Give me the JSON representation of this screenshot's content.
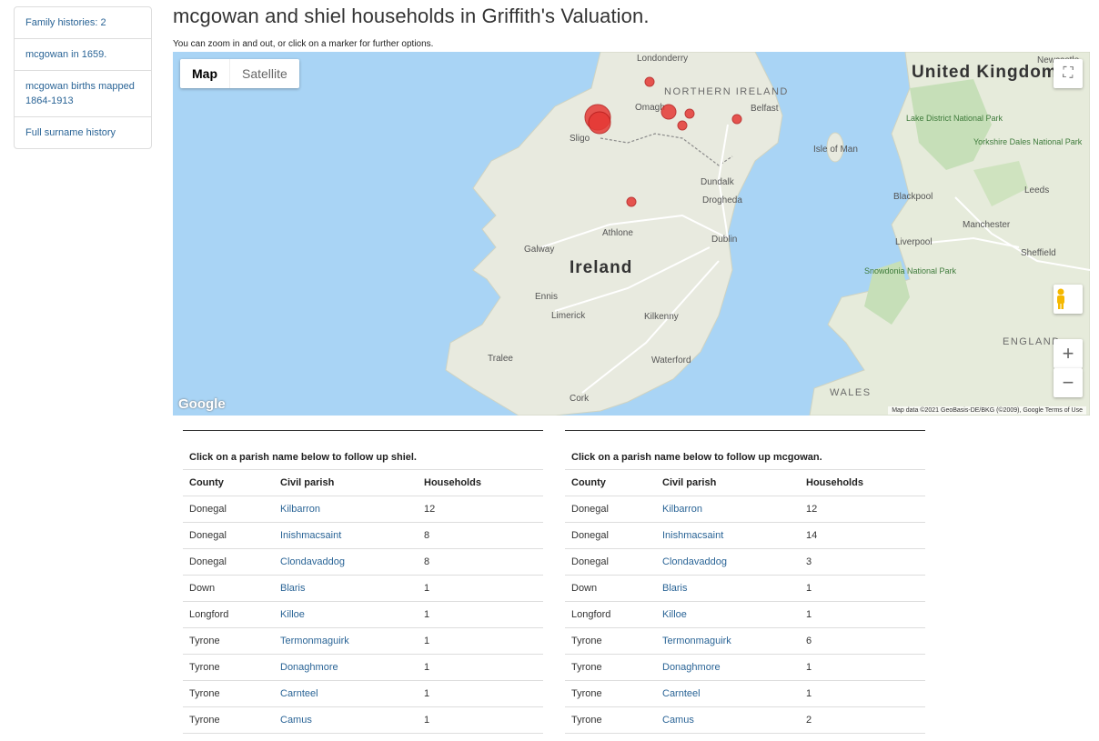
{
  "sidenav": [
    {
      "label": "Family histories: 2"
    },
    {
      "label": "mcgowan in 1659."
    },
    {
      "label": "mcgowan births mapped 1864-1913"
    },
    {
      "label": "Full surname history"
    }
  ],
  "page_title": "mcgowan and shiel households in Griffith's Valuation.",
  "subtitle": "You can zoom in and out, or click on a marker for further options.",
  "map": {
    "type_map": "Map",
    "type_satellite": "Satellite",
    "fullscreen_icon": "fullscreen-icon",
    "zoom_in": "+",
    "zoom_out": "−",
    "pegman_icon": "pegman-icon",
    "logo": "Google",
    "footer": "Map data ©2021 GeoBasis-DE/BKG (©2009), Google   Terms of Use",
    "labels": {
      "ireland": "Ireland",
      "uk": "United Kingdom",
      "ni": "NORTHERN IRELAND",
      "england": "ENGLAND",
      "wales": "WALES",
      "isle_of_man": "Isle of Man",
      "londonderry": "Londonderry",
      "belfast": "Belfast",
      "sligo": "Sligo",
      "dublin": "Dublin",
      "galway": "Galway",
      "limerick": "Limerick",
      "cork": "Cork",
      "waterford": "Waterford",
      "kilkenny": "Kilkenny",
      "athlone": "Athlone",
      "drogheda": "Drogheda",
      "dundalk": "Dundalk",
      "omagh": "Omagh",
      "tralee": "Tralee",
      "ennis": "Ennis",
      "blackpool": "Blackpool",
      "leeds": "Leeds",
      "manchester": "Manchester",
      "liverpool": "Liverpool",
      "sheffield": "Sheffield",
      "newcastle": "Newcastle",
      "snowdonia": "Snowdonia National Park",
      "lake_district": "Lake District National Park",
      "yorkshire": "Yorkshire Dales National Park"
    },
    "marker_color": "#e53935"
  },
  "tables": [
    {
      "caption": "Click on a parish name below to follow up shiel.",
      "headers": [
        "County",
        "Civil parish",
        "Households"
      ],
      "rows": [
        [
          "Donegal",
          "Kilbarron",
          "12"
        ],
        [
          "Donegal",
          "Inishmacsaint",
          "8"
        ],
        [
          "Donegal",
          "Clondavaddog",
          "8"
        ],
        [
          "Down",
          "Blaris",
          "1"
        ],
        [
          "Longford",
          "Killoe",
          "1"
        ],
        [
          "Tyrone",
          "Termonmaguirk",
          "1"
        ],
        [
          "Tyrone",
          "Donaghmore",
          "1"
        ],
        [
          "Tyrone",
          "Carnteel",
          "1"
        ],
        [
          "Tyrone",
          "Camus",
          "1"
        ]
      ]
    },
    {
      "caption": "Click on a parish name below to follow up mcgowan.",
      "headers": [
        "County",
        "Civil parish",
        "Households"
      ],
      "rows": [
        [
          "Donegal",
          "Kilbarron",
          "12"
        ],
        [
          "Donegal",
          "Inishmacsaint",
          "14"
        ],
        [
          "Donegal",
          "Clondavaddog",
          "3"
        ],
        [
          "Down",
          "Blaris",
          "1"
        ],
        [
          "Longford",
          "Killoe",
          "1"
        ],
        [
          "Tyrone",
          "Termonmaguirk",
          "6"
        ],
        [
          "Tyrone",
          "Donaghmore",
          "1"
        ],
        [
          "Tyrone",
          "Carnteel",
          "1"
        ],
        [
          "Tyrone",
          "Camus",
          "2"
        ]
      ]
    }
  ]
}
